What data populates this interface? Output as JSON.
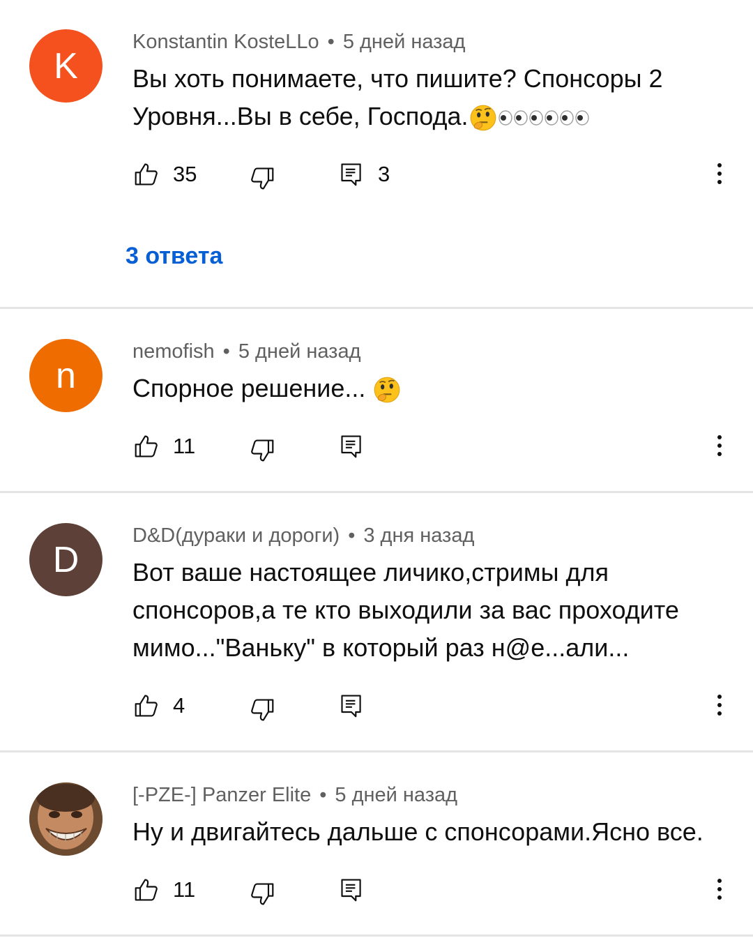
{
  "comments": [
    {
      "avatar_letter": "K",
      "avatar_color": "#f4511e",
      "author": "Konstantin KosteLLo",
      "time": "5 дней назад",
      "text_line1": "Вы хоть понимаете, что пишите? Спонсоры 2",
      "text_line2": "Уровня...Вы в себе, Господа.",
      "likes": "35",
      "reply_count": "3",
      "replies_link": "3 ответа",
      "emojis": [
        "thinking-face-emoji",
        "eyes-emoji",
        "eyes-emoji",
        "eyes-emoji"
      ]
    },
    {
      "avatar_letter": "n",
      "avatar_color": "#ef6c00",
      "author": "nemofish",
      "time": "5 дней назад",
      "text": "Спорное решение...",
      "likes": "11",
      "emojis": [
        "thinking-face-emoji"
      ]
    },
    {
      "avatar_letter": "D",
      "avatar_color": "#5d4037",
      "author": "D&D(дураки и дороги)",
      "time": "3 дня назад",
      "text_line1": "Вот ваше настоящее личико,стримы для",
      "text_line2": "спонсоров,а те кто выходили за вас проходите",
      "text_line3": "мимо...\"Ваньку\" в который раз н@е...али...",
      "likes": "4"
    },
    {
      "avatar_photo": "grinning-face-photo",
      "author": "[-PZE-] Panzer Elite",
      "time": "5 дней назад",
      "text": "Ну и двигайтесь дальше с спонсорами.Ясно все.",
      "likes": "11"
    }
  ],
  "separator": "•",
  "icons": {
    "like": "thumbs-up-icon",
    "dislike": "thumbs-down-icon",
    "reply": "reply-icon",
    "more": "more-vertical-icon"
  },
  "colors": {
    "link_blue": "#065fd4",
    "meta_gray": "#606060",
    "divider": "#e5e5e5"
  }
}
